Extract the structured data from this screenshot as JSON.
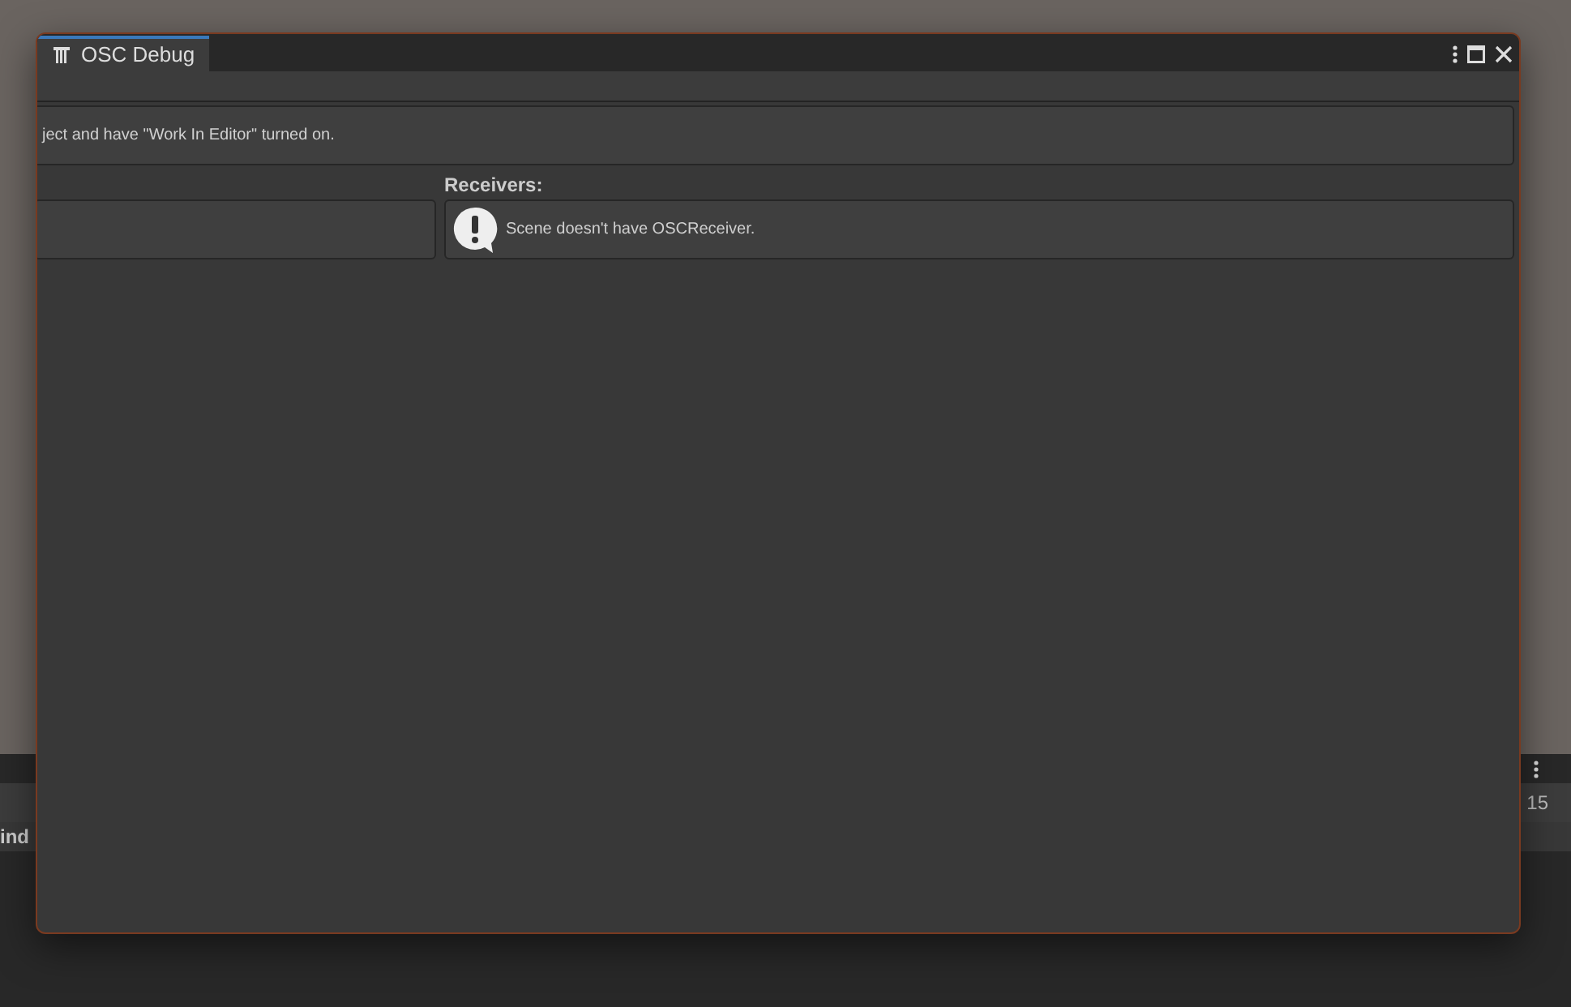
{
  "background": {
    "count": "15",
    "label": "ind"
  },
  "window": {
    "tab": {
      "title": "OSC Debug",
      "selected": true
    }
  },
  "help_box": {
    "text": "ject and have \"Work In Editor\" turned on."
  },
  "receivers": {
    "heading": "Receivers:",
    "message": "Scene doesn't have OSCReceiver."
  }
}
